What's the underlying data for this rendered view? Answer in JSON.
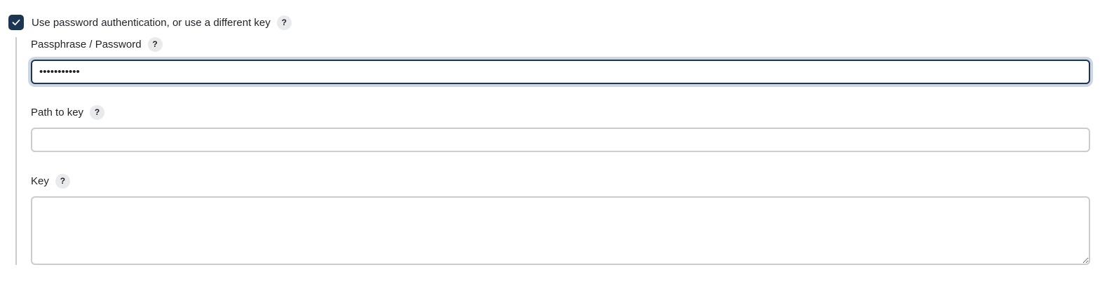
{
  "use_password_checkbox": {
    "checked": true,
    "label": "Use password authentication, or use a different key",
    "help": "?"
  },
  "passphrase": {
    "label": "Passphrase / Password",
    "help": "?",
    "value": "•••••••••••",
    "type": "password"
  },
  "path_to_key": {
    "label": "Path to key",
    "help": "?",
    "value": ""
  },
  "key": {
    "label": "Key",
    "help": "?",
    "value": ""
  },
  "colors": {
    "accent": "#1c3552",
    "focus_ring": "#cfd6e2",
    "border": "#c9ccd1",
    "help_bg": "#e9eaec"
  },
  "icons": {
    "checkbox": "check-icon",
    "help": "question-mark-icon"
  }
}
